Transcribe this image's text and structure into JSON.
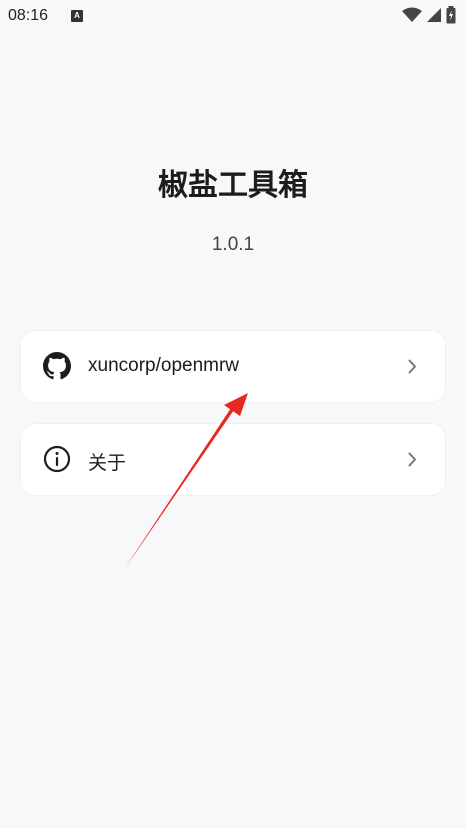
{
  "status_bar": {
    "time": "08:16",
    "notification_icon_letter": "A"
  },
  "app": {
    "title": "椒盐工具箱",
    "version": "1.0.1"
  },
  "menu": {
    "items": [
      {
        "label": "xuncorp/openmrw",
        "icon": "github-icon"
      },
      {
        "label": "关于",
        "icon": "info-icon"
      }
    ]
  },
  "colors": {
    "background": "#f7f8fa",
    "card": "#ffffff",
    "annotation_arrow": "#e8281e"
  }
}
